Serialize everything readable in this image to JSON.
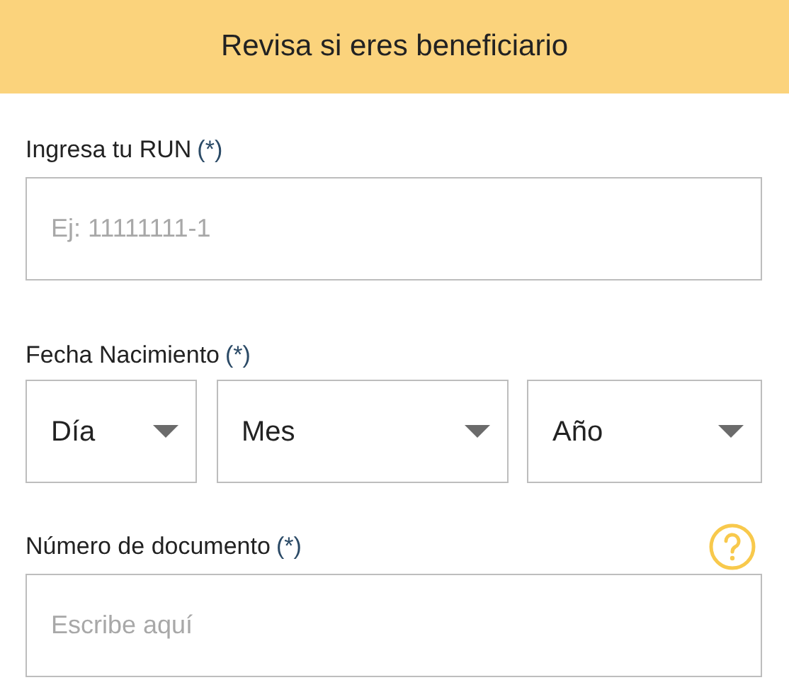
{
  "header": {
    "title": "Revisa si eres beneficiario"
  },
  "fields": [
    {
      "kind": "text",
      "label": "Ingresa tu RUN",
      "required_mark": "(*)",
      "placeholder": "Ej: 11111111-1",
      "help": false
    },
    {
      "kind": "date",
      "label": "Fecha Nacimiento",
      "required_mark": "(*)",
      "selects": [
        "Día",
        "Mes",
        "Año"
      ],
      "help": false
    },
    {
      "kind": "text",
      "label": "Número de documento",
      "required_mark": "(*)",
      "placeholder": "Escribe aquí",
      "help": true
    }
  ]
}
